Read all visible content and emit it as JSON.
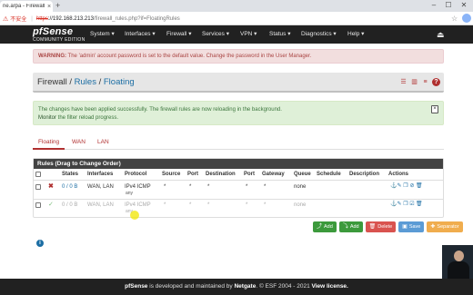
{
  "browser": {
    "tab_title": "ne.arpa - Firewall:",
    "tab_close": "×",
    "new_tab": "+",
    "insecure_label": "不安全",
    "url_proto": "https",
    "url_host": "://192.168.213.213",
    "url_path": "/firewall_rules.php?if=FloatingRules",
    "win_min": "–",
    "win_max": "☐",
    "win_close": "✕"
  },
  "nav": {
    "logo": "pfSense",
    "edition": "COMMUNITY EDITION",
    "menu": [
      "System ▾",
      "Interfaces ▾",
      "Firewall ▾",
      "Services ▾",
      "VPN ▾",
      "Status ▾",
      "Diagnostics ▾",
      "Help ▾"
    ],
    "logout": "⏏"
  },
  "alert_password": {
    "prefix": "WARNING:",
    "text": " The 'admin' account password is set to the default value. Change the password in the User Manager."
  },
  "breadcrumb": {
    "part1": "Firewall",
    "sep1": " / ",
    "part2": "Rules",
    "sep2": " / ",
    "part3": "Floating"
  },
  "alert_success": {
    "line1": "The changes have been applied successfully. The firewall rules are now reloading in the background.",
    "line2_link": "Monitor",
    "line2_rest": " the filter reload progress.",
    "close": "×"
  },
  "tabs": [
    "Floating",
    "WAN",
    "LAN"
  ],
  "table": {
    "title": "Rules (Drag to Change Order)",
    "headers": [
      "States",
      "Interfaces",
      "Protocol",
      "Source",
      "Port",
      "Destination",
      "Port",
      "Gateway",
      "Queue",
      "Schedule",
      "Description",
      "Actions"
    ],
    "rows": [
      {
        "state_icon": "✖",
        "states": "0 / 0 B",
        "interfaces": "WAN, LAN",
        "protocol": "IPv4 ICMP",
        "protocol_sub": "any",
        "source": "*",
        "port": "*",
        "destination": "*",
        "dport": "*",
        "gateway": "*",
        "queue": "none",
        "schedule": "",
        "description": ""
      },
      {
        "state_icon": "✓",
        "states": "0 / 0 B",
        "interfaces": "WAN, LAN",
        "protocol": "IPv4 ICMP",
        "protocol_sub": "any",
        "source": "*",
        "port": "*",
        "destination": "*",
        "dport": "*",
        "gateway": "*",
        "queue": "none",
        "schedule": "",
        "description": ""
      }
    ]
  },
  "buttons": {
    "add_top": "Add",
    "add_bottom": "Add",
    "delete": "Delete",
    "save": "Save",
    "separator": "Separator"
  },
  "footer": {
    "brand": "pfSense",
    "text1": " is developed and maintained by ",
    "netgate": "Netgate",
    "text2": ". © ESF 2004 - 2021 ",
    "license": "View license."
  },
  "colors": {
    "nav_bg": "#212121",
    "link": "#1c6ea4",
    "danger": "#d9534f",
    "success": "#5cb85c",
    "primary": "#5bc0de",
    "warning": "#f0ad4e"
  }
}
